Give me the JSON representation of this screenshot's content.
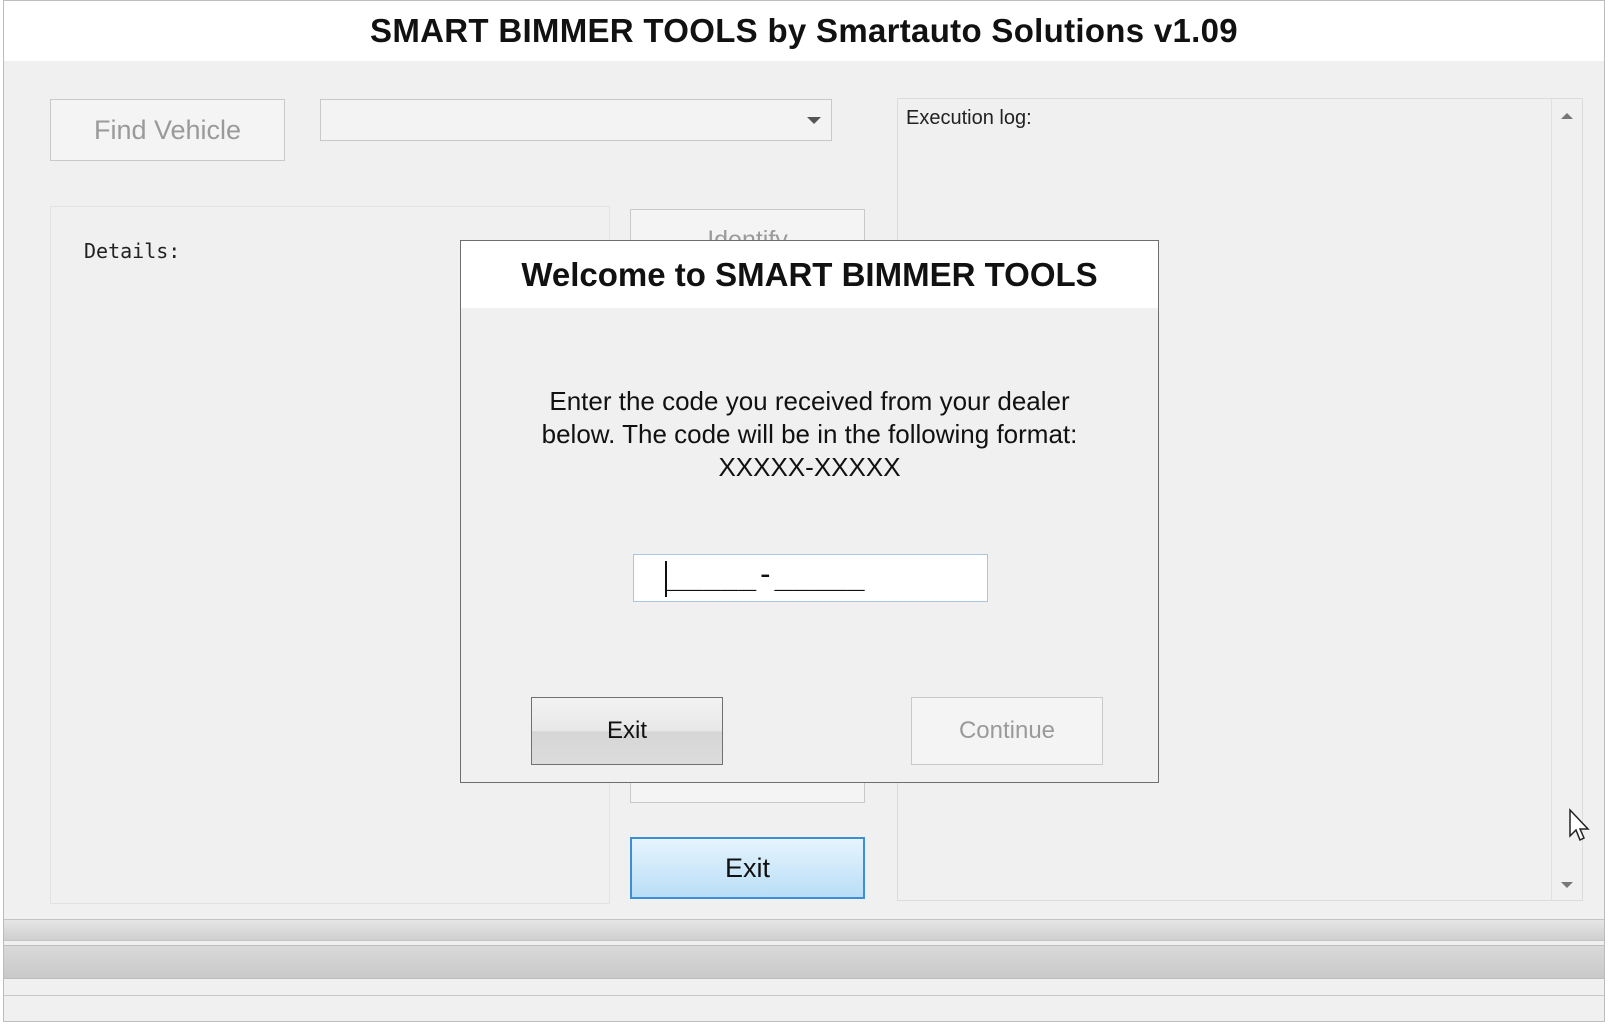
{
  "window": {
    "title": "SMART BIMMER TOOLS by Smartauto Solutions v1.09"
  },
  "main": {
    "find_vehicle_label": "Find Vehicle",
    "vehicle_select_value": "",
    "details_label": "Details:",
    "identify_label": "Identify",
    "exit_label": "Exit",
    "log_label": "Execution log:"
  },
  "dialog": {
    "title": "Welcome to SMART BIMMER TOOLS",
    "message_line1": "Enter the code you received from your dealer",
    "message_line2": "below. The code will be in the following format:",
    "message_line3": "XXXXX-XXXXX",
    "code_mask": "_____-_____",
    "exit_label": "Exit",
    "continue_label": "Continue"
  },
  "colors": {
    "accent": "#3c8fd6",
    "window_bg": "#f0f0f0",
    "disabled_text": "#9a9a9a"
  }
}
